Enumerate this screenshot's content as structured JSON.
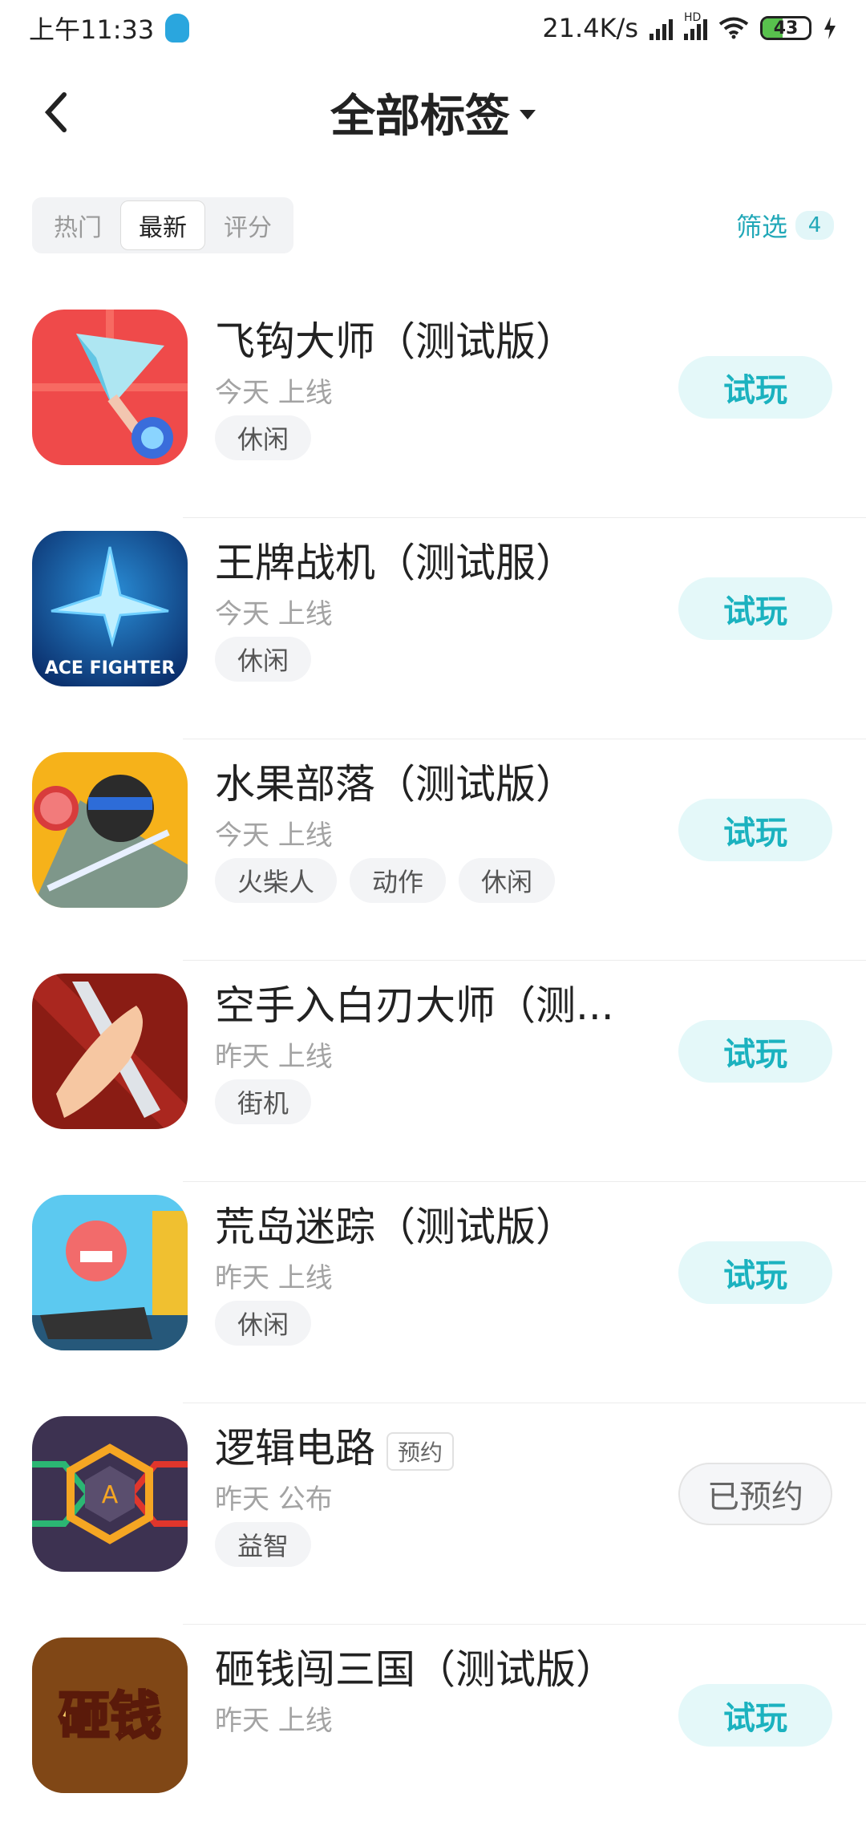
{
  "status": {
    "time": "上午11:33",
    "speed": "21.4K/s",
    "network": "HD",
    "battery": "43",
    "battery_level": 0.43
  },
  "header": {
    "title": "全部标签"
  },
  "tabs": {
    "items": [
      {
        "label": "热门"
      },
      {
        "label": "最新"
      },
      {
        "label": "评分"
      }
    ],
    "active": "最新",
    "filter_label": "筛选",
    "filter_count": "4"
  },
  "apps": [
    {
      "name": "飞钩大师（测试版）",
      "sub": "今天 上线",
      "tags": [
        "休闲"
      ],
      "action": "试玩"
    },
    {
      "name": "王牌战机（测试服）",
      "sub": "今天 上线",
      "tags": [
        "休闲"
      ],
      "action": "试玩",
      "icon_text": "ACE FIGHTER"
    },
    {
      "name": "水果部落（测试版）",
      "sub": "今天 上线",
      "tags": [
        "火柴人",
        "动作",
        "休闲"
      ],
      "action": "试玩"
    },
    {
      "name": "空手入白刃大师（测...",
      "sub": "昨天 上线",
      "tags": [
        "街机"
      ],
      "action": "试玩"
    },
    {
      "name": "荒岛迷踪（测试版）",
      "sub": "昨天 上线",
      "tags": [
        "休闲"
      ],
      "action": "试玩"
    },
    {
      "name": "逻辑电路",
      "badge": "预约",
      "sub": "昨天 公布",
      "tags": [
        "益智"
      ],
      "action": "已预约",
      "icon_text": "A"
    },
    {
      "name": "砸钱闯三国（测试版）",
      "sub": "昨天 上线",
      "tags": [],
      "action": "试玩",
      "icon_text": "砸钱"
    }
  ]
}
